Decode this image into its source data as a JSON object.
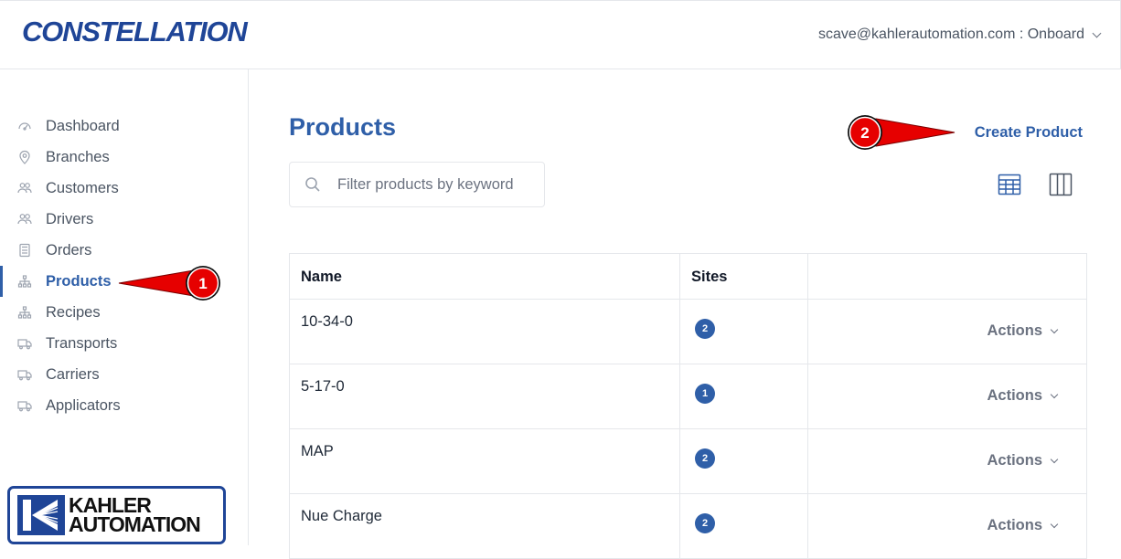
{
  "header": {
    "brand": "CONSTELLATION",
    "user_menu": "scave@kahlerautomation.com : Onboard"
  },
  "sidebar": {
    "items": [
      {
        "label": "Dashboard",
        "icon": "gauge-icon"
      },
      {
        "label": "Branches",
        "icon": "map-pin-icon"
      },
      {
        "label": "Customers",
        "icon": "users-icon"
      },
      {
        "label": "Drivers",
        "icon": "users-icon"
      },
      {
        "label": "Orders",
        "icon": "calculator-icon"
      },
      {
        "label": "Products",
        "icon": "hierarchy-icon",
        "active": true
      },
      {
        "label": "Recipes",
        "icon": "hierarchy-icon"
      },
      {
        "label": "Transports",
        "icon": "truck-icon"
      },
      {
        "label": "Carriers",
        "icon": "truck-icon"
      },
      {
        "label": "Applicators",
        "icon": "truck-icon"
      }
    ],
    "logo_line1": "KAHLER",
    "logo_line2": "AUTOMATION"
  },
  "main": {
    "title": "Products",
    "create_label": "Create Product",
    "search_placeholder": "Filter products by keyword",
    "table": {
      "headers": [
        "Name",
        "Sites",
        ""
      ],
      "rows": [
        {
          "name": "10-34-0",
          "sites": "2",
          "actions": "Actions"
        },
        {
          "name": "5-17-0",
          "sites": "1",
          "actions": "Actions"
        },
        {
          "name": "MAP",
          "sites": "2",
          "actions": "Actions"
        },
        {
          "name": "Nue Charge",
          "sites": "2",
          "actions": "Actions"
        }
      ]
    }
  },
  "callouts": {
    "one": "1",
    "two": "2"
  },
  "colors": {
    "accent": "#2f5fa8",
    "callout_red": "#e60000",
    "brand": "#1f4597"
  }
}
